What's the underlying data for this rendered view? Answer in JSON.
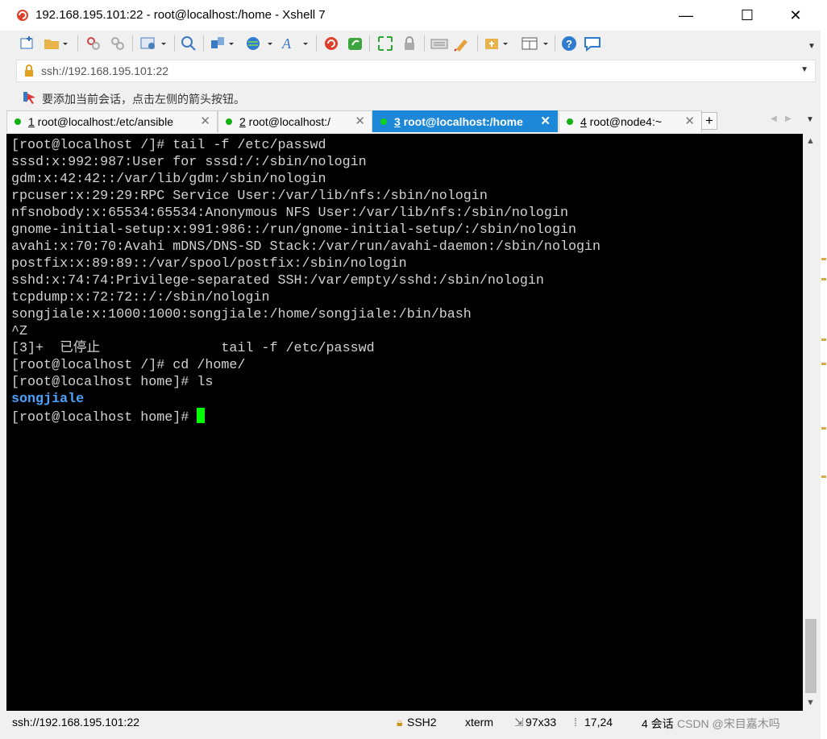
{
  "window": {
    "title": "192.168.195.101:22 - root@localhost:/home - Xshell 7",
    "minimize_glyph": "—",
    "maximize_glyph": "☐",
    "close_glyph": "✕"
  },
  "toolbar": {
    "icons": [
      "new-session-icon",
      "open-folder-icon",
      "disconnect-icon",
      "reconnect-icon",
      "properties-icon",
      "find-icon",
      "transfer-icon",
      "globe-icon",
      "font-icon",
      "xshell-icon",
      "xftp-icon",
      "fullscreen-icon",
      "lock-icon",
      "keyboard-icon",
      "highlight-icon",
      "add-script-icon",
      "layout-icon",
      "help-icon",
      "chat-icon"
    ]
  },
  "address_bar": {
    "value": "ssh://192.168.195.101:22"
  },
  "hint_bar": {
    "text": "要添加当前会话，点击左侧的箭头按钮。"
  },
  "tabs": [
    {
      "number": "1",
      "label": " root@localhost:/etc/ansible",
      "active": false
    },
    {
      "number": "2",
      "label": " root@localhost:/",
      "active": false
    },
    {
      "number": "3",
      "label": " root@localhost:/home",
      "active": true
    },
    {
      "number": "4",
      "label": " root@node4:~",
      "active": false
    }
  ],
  "tab_add_glyph": "+",
  "terminal": {
    "lines": [
      "[root@localhost /]# tail -f /etc/passwd",
      "sssd:x:992:987:User for sssd:/:/sbin/nologin",
      "gdm:x:42:42::/var/lib/gdm:/sbin/nologin",
      "rpcuser:x:29:29:RPC Service User:/var/lib/nfs:/sbin/nologin",
      "nfsnobody:x:65534:65534:Anonymous NFS User:/var/lib/nfs:/sbin/nologin",
      "gnome-initial-setup:x:991:986::/run/gnome-initial-setup/:/sbin/nologin",
      "avahi:x:70:70:Avahi mDNS/DNS-SD Stack:/var/run/avahi-daemon:/sbin/nologin",
      "postfix:x:89:89::/var/spool/postfix:/sbin/nologin",
      "sshd:x:74:74:Privilege-separated SSH:/var/empty/sshd:/sbin/nologin",
      "tcpdump:x:72:72::/:/sbin/nologin",
      "songjiale:x:1000:1000:songjiale:/home/songjiale:/bin/bash",
      "^Z",
      "[3]+  已停止               tail -f /etc/passwd",
      "[root@localhost /]# cd /home/",
      "[root@localhost home]# ls"
    ],
    "dir_listing": "songjiale",
    "prompt": "[root@localhost home]# "
  },
  "status_bar": {
    "address": "ssh://192.168.195.101:22",
    "protocol": "SSH2",
    "terminal_type": "xterm",
    "size": "97x33",
    "cursor_pos": "17,24",
    "sessions": "4 会话",
    "watermark": "CSDN @宋目嘉木吗"
  },
  "colors": {
    "terminal_bg": "#000000",
    "terminal_fg": "#d2d2d2",
    "directory": "#4aa3ff",
    "cursor": "#00ff00",
    "active_tab": "#1e88d8",
    "session_dot": "#12b012"
  }
}
